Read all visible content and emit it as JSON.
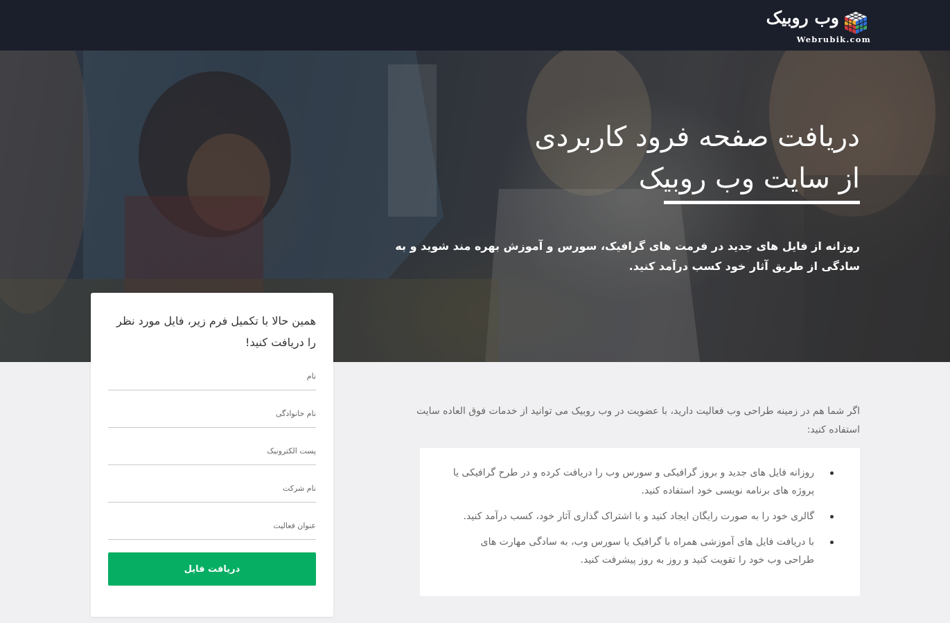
{
  "header": {
    "logo_fa": "وب روبیک",
    "logo_en": "Webrubik.com"
  },
  "hero": {
    "title_line1": "دریافت صفحه فرود کاربردی",
    "title_line2": "از سایت وب روبیک",
    "description": "روزانه از فایل های جدید در فرمت های گرافیک، سورس و آموزش بهره مند شوید و به سادگی از طریق آثار خود کسب درآمد کنید."
  },
  "form": {
    "intro": "همین حالا با تکمیل فرم زیر، فایل مورد نظر را دریافت کنید!",
    "fields": {
      "first_name": "نام",
      "last_name": "نام خانوادگی",
      "email": "پست الکترونیک",
      "company": "نام شرکت",
      "job_title": "عنوان فعالیت"
    },
    "submit_label": "دریافت فایل"
  },
  "content": {
    "intro": "اگر شما هم در زمینه طراحی وب فعالیت دارید، با عضویت در وب روبیک می توانید از خدمات فوق العاده سایت استفاده کنید:",
    "benefits": [
      "روزانه فایل های جدید و بروز گرافیکی و سورس وب را دریافت کرده و در طرح گرافیکی یا پروژه های برنامه نویسی خود استفاده کنید.",
      "گالری خود را به صورت رایگان ایجاد کنید و با اشتراک گذاری آثار خود، کسب درآمد کنید.",
      "با دریافت فایل های آموزشی همراه با گرافیک یا سورس وب، به سادگی مهارت های طراحی وب خود را تقویت کنید و روز به روز پیشرفت کنید."
    ]
  },
  "colors": {
    "topbar": "#1b1f2b",
    "accent_green": "#05ae63",
    "page_bg": "#f0f0f2"
  }
}
